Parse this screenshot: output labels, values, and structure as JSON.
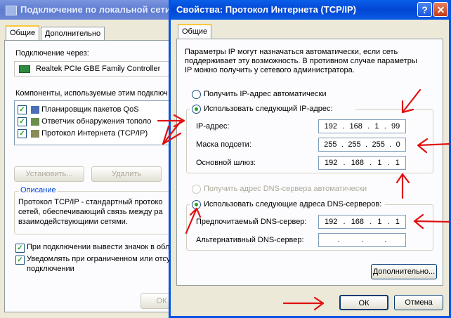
{
  "back_window": {
    "title": "Подключение по локальной сети",
    "tabs": [
      "Общие",
      "Дополнительно"
    ],
    "connect_using_label": "Подключение через:",
    "adapter_name": "Realtek PCIe GBE Family Controller",
    "components_label": "Компоненты, используемые этим подключ",
    "components": [
      {
        "label": "Планировщик пакетов QoS",
        "checked": true
      },
      {
        "label": "Ответчик обнаружения тополо",
        "checked": true
      },
      {
        "label": "Протокол Интернета (TCP/IP)",
        "checked": true
      }
    ],
    "install_button": "Установить...",
    "remove_button": "Удалить",
    "description_title": "Описание",
    "description_text": "Протокол TCP/IP - стандартный протоко сетей, обеспечивающий связь между ра взаимодействующими сетями.",
    "description_lines": [
      "Протокол TCP/IP - стандартный протоко",
      "сетей, обеспечивающий связь между ра",
      "взаимодействующими сетями."
    ],
    "show_icon_label": "При подключении вывести значок в обл",
    "notify_label_lines": [
      "Уведомлять при ограниченном или отсу",
      "подключении"
    ],
    "ok_button": "ОК"
  },
  "front_window": {
    "title": "Свойства: Протокол Интернета (TCP/IP)",
    "help_glyph": "?",
    "close_glyph": "✕",
    "tab": "Общие",
    "intro_lines": [
      "Параметры IP могут назначаться автоматически, если сеть",
      "поддерживает эту возможность. В противном случае параметры",
      "IP можно получить у сетевого администратора."
    ],
    "radio_auto_ip": "Получить IP-адрес автоматически",
    "radio_manual_ip": "Использовать следующий IP-адрес:",
    "ip_label": "IP-адрес:",
    "ip_value": [
      "192",
      "168",
      "1",
      "99"
    ],
    "mask_label": "Маска подсети:",
    "mask_value": [
      "255",
      "255",
      "255",
      "0"
    ],
    "gateway_label": "Основной шлюз:",
    "gateway_value": [
      "192",
      "168",
      "1",
      "1"
    ],
    "radio_auto_dns": "Получить адрес DNS-сервера автоматически",
    "radio_manual_dns": "Использовать следующие адреса DNS-серверов:",
    "preferred_dns_label": "Предпочитаемый DNS-сервер:",
    "preferred_dns_value": [
      "192",
      "168",
      "1",
      "1"
    ],
    "alternate_dns_label": "Альтернативный DNS-сервер:",
    "alternate_dns_value": [
      "",
      "",
      "",
      ""
    ],
    "advanced_button": "Дополнительно...",
    "ok_button": "ОК",
    "cancel_button": "Отмена"
  },
  "annotation_color": "#e01010"
}
